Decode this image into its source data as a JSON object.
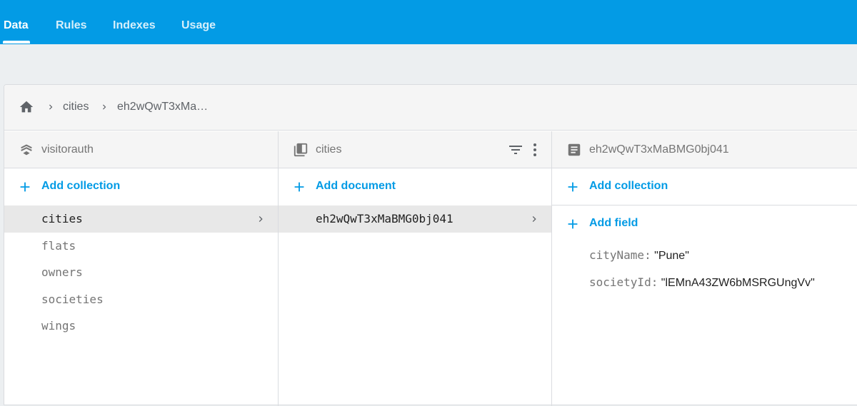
{
  "tabs": [
    {
      "label": "Data",
      "active": true
    },
    {
      "label": "Rules",
      "active": false
    },
    {
      "label": "Indexes",
      "active": false
    },
    {
      "label": "Usage",
      "active": false
    }
  ],
  "breadcrumb": {
    "home_icon": "home-icon",
    "items": [
      "cities",
      "eh2wQwT3xMa…"
    ]
  },
  "columns": {
    "root": {
      "title": "visitorauth",
      "icon": "layers-icon",
      "add_label": "Add collection",
      "items": [
        "cities",
        "flats",
        "owners",
        "societies",
        "wings"
      ],
      "selected": "cities"
    },
    "collection": {
      "title": "cities",
      "icon": "collection-icon",
      "add_label": "Add document",
      "items": [
        "eh2wQwT3xMaBMG0bj041"
      ],
      "selected": "eh2wQwT3xMaBMG0bj041"
    },
    "document": {
      "title": "eh2wQwT3xMaBMG0bj041",
      "icon": "document-icon",
      "add_collection_label": "Add collection",
      "add_field_label": "Add field",
      "fields": [
        {
          "key": "cityName:",
          "value": "\"Pune\""
        },
        {
          "key": "societyId:",
          "value": "\"lEMnA43ZW6bMSRGUngVv\""
        }
      ]
    }
  },
  "colors": {
    "accent": "#039be5",
    "tab_bar": "#039be5",
    "selected_row": "#e8e8e8"
  }
}
